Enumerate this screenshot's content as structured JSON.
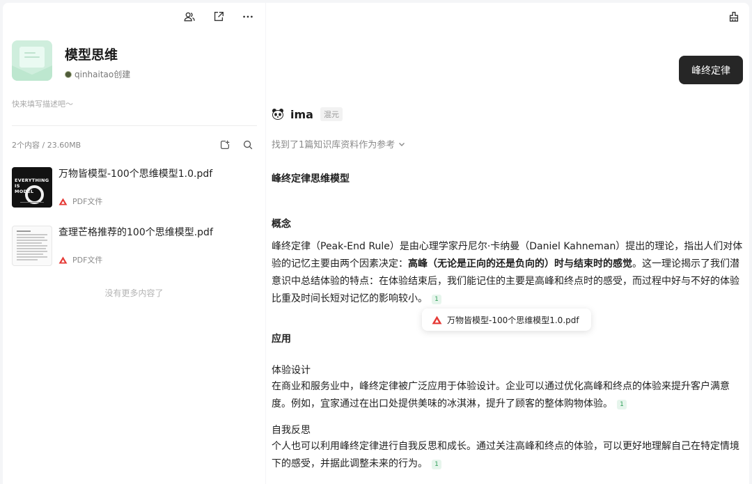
{
  "left_panel": {
    "kb_title": "模型思维",
    "creator": "qinhaitao创建",
    "description_placeholder": "快来填写描述吧～",
    "content_count": "2个内容 / 23.60MB",
    "files": [
      {
        "name": "万物皆模型-100个思维模型1.0.pdf",
        "type": "PDF文件",
        "thumb_text": "EVERYTHING\nIS\nMODEL"
      },
      {
        "name": "查理芒格推荐的100个思维模型.pdf",
        "type": "PDF文件"
      }
    ],
    "no_more": "没有更多内容了"
  },
  "right_panel": {
    "tag_button": "峰终定律",
    "assistant_name": "ima",
    "model_badge": "混元",
    "refs_found": "找到了1篇知识库资料作为参考",
    "sections": {
      "title": "峰终定律思维模型",
      "concept_heading": "概念",
      "concept_p1": "峰终定律（Peak-End Rule）是由心理学家丹尼尔·卡纳曼（Daniel Kahneman）提出的理论，指出人们对体验的记忆主要由两个因素决定：",
      "concept_bold": "高峰（无论是正向的还是负向的）时与结束时的感觉",
      "concept_p2": "。这一理论揭示了我们潜意识中总结体验的特点：在体验结束后，我们能记住的主要是高峰和终点时的感受，而过程中好与不好的体验比重及时间长短对记忆的影响较小。",
      "application_heading": "应用",
      "app1_title": "体验设计",
      "app1_text": "在商业和服务业中，峰终定律被广泛应用于体验设计。企业可以通过优化高峰和终点的体验来提升客户满意度。例如，宜家通过在出口处提供美味的冰淇淋，提升了顾客的整体购物体验。",
      "app2_title": "自我反思",
      "app2_text": "个人也可以利用峰终定律进行自我反思和成长。通过关注高峰和终点的体验，可以更好地理解自己在特定情境下的感受，并据此调整未来的行为。",
      "citation": "1"
    },
    "citation_popup": "万物皆模型-100个思维模型1.0.pdf"
  },
  "icons": [
    "members-icon",
    "share-icon",
    "more-icon",
    "add-file-icon",
    "search-icon",
    "clear-icon",
    "pdf-icon",
    "panda-avatar-icon",
    "chevron-down-icon"
  ],
  "colors": {
    "accent_green": "#2f9e58",
    "pdf_red": "#e53935",
    "dark_button": "#262626"
  }
}
